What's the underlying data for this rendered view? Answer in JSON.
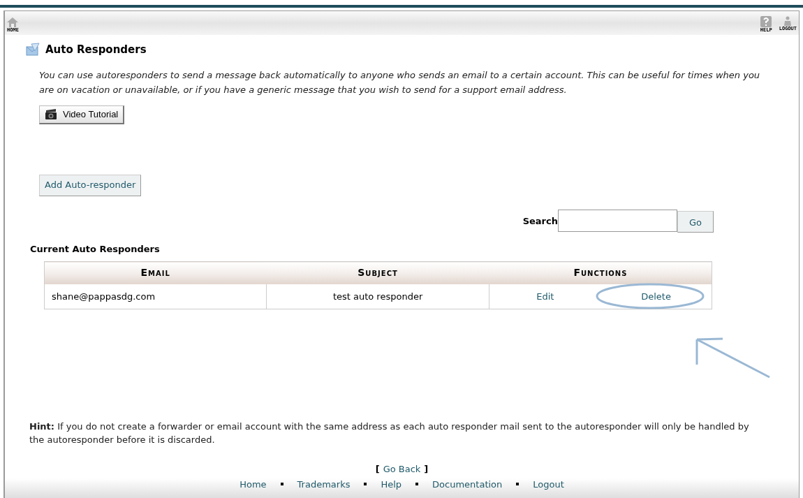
{
  "toolbar": {
    "left": [
      {
        "kind": "home",
        "label": "HOME"
      }
    ],
    "right": [
      {
        "kind": "help",
        "label": "HELP"
      },
      {
        "kind": "logout",
        "label": "LOGOUT"
      }
    ]
  },
  "page": {
    "title": "Auto Responders",
    "description": "You can use autoresponders to send a message back automatically to anyone who sends an email to a certain account. This can be useful for times when you are on vacation or unavailable, or if you have a generic message that you wish to send for a support email address.",
    "video_button": "Video Tutorial",
    "add_button": "Add Auto-responder"
  },
  "search": {
    "label": "Search",
    "button": "Go"
  },
  "table": {
    "title": "Current Auto Responders",
    "columns": [
      "Email",
      "Subject",
      "Functions"
    ],
    "rows": [
      {
        "email": "shane@pappasdg.com",
        "subject": "test auto responder",
        "actions": [
          "Edit",
          "Delete"
        ]
      }
    ]
  },
  "hint": "**Hint:** If you do not create a forwarder or email account with the same address as each auto responder mail sent to the autoresponder will only be handled by the autoresponder before it is discarded.",
  "go_back": {
    "open": "[",
    "link": "Go Back",
    "close": "]"
  },
  "footer": [
    "Home",
    "Trademarks",
    "Help",
    "Documentation",
    "Logout"
  ]
}
